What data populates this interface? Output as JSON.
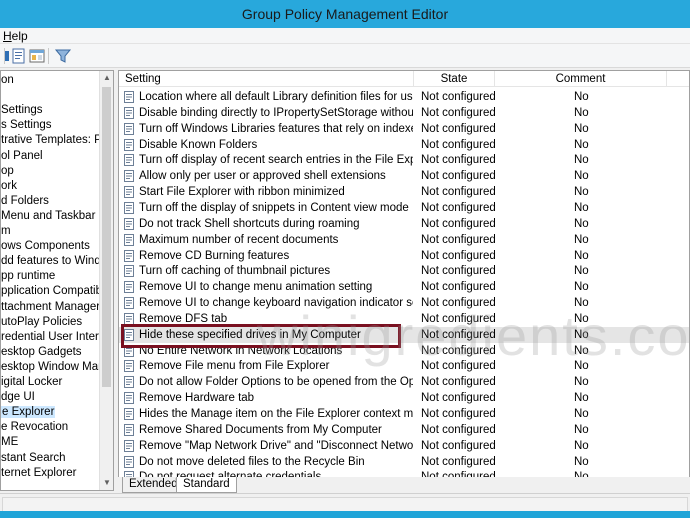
{
  "window": {
    "title": "Group Policy Management Editor"
  },
  "menu": {
    "help_prefix": "",
    "help_accel": "H",
    "help_rest": "elp"
  },
  "toolbar": {
    "icons": [
      "properties-icon",
      "show-hide-pane-icon",
      "filter-icon"
    ]
  },
  "tree": {
    "items": [
      {
        "label": "on",
        "selected": false
      },
      {
        "label": "",
        "selected": false
      },
      {
        "label": " Settings",
        "selected": false
      },
      {
        "label": "s Settings",
        "selected": false
      },
      {
        "label": "trative Templates: Policy",
        "selected": false
      },
      {
        "label": "ol Panel",
        "selected": false
      },
      {
        "label": "op",
        "selected": false
      },
      {
        "label": "ork",
        "selected": false
      },
      {
        "label": "d Folders",
        "selected": false
      },
      {
        "label": "Menu and Taskbar",
        "selected": false
      },
      {
        "label": "m",
        "selected": false
      },
      {
        "label": "ows Components",
        "selected": false
      },
      {
        "label": "dd features to Windows",
        "selected": false
      },
      {
        "label": "pp runtime",
        "selected": false
      },
      {
        "label": "pplication Compatibilit",
        "selected": false
      },
      {
        "label": "ttachment Manager",
        "selected": false
      },
      {
        "label": "utoPlay Policies",
        "selected": false
      },
      {
        "label": "redential User Interface",
        "selected": false
      },
      {
        "label": "esktop Gadgets",
        "selected": false
      },
      {
        "label": "esktop Window Manag",
        "selected": false
      },
      {
        "label": "igital Locker",
        "selected": false
      },
      {
        "label": "dge UI",
        "selected": false
      },
      {
        "label": "e Explorer",
        "selected": true
      },
      {
        "label": "e Revocation",
        "selected": false
      },
      {
        "label": "ME",
        "selected": false
      },
      {
        "label": "stant Search",
        "selected": false
      },
      {
        "label": "ternet Explorer",
        "selected": false
      }
    ]
  },
  "list": {
    "columns": {
      "setting": "Setting",
      "state": "State",
      "comment": "Comment"
    },
    "rows": [
      {
        "setting": "Location where all default Library definition files for users/m...",
        "state": "Not configured",
        "comment": "No"
      },
      {
        "setting": "Disable binding directly to IPropertySetStorage without inter...",
        "state": "Not configured",
        "comment": "No"
      },
      {
        "setting": "Turn off Windows Libraries features that rely on indexed file ...",
        "state": "Not configured",
        "comment": "No"
      },
      {
        "setting": "Disable Known Folders",
        "state": "Not configured",
        "comment": "No"
      },
      {
        "setting": "Turn off display of recent search entries in the File Explorer s...",
        "state": "Not configured",
        "comment": "No"
      },
      {
        "setting": "Allow only per user or approved shell extensions",
        "state": "Not configured",
        "comment": "No"
      },
      {
        "setting": "Start File Explorer with ribbon minimized",
        "state": "Not configured",
        "comment": "No"
      },
      {
        "setting": "Turn off the display of snippets in Content view mode",
        "state": "Not configured",
        "comment": "No"
      },
      {
        "setting": "Do not track Shell shortcuts during roaming",
        "state": "Not configured",
        "comment": "No"
      },
      {
        "setting": "Maximum number of recent documents",
        "state": "Not configured",
        "comment": "No"
      },
      {
        "setting": "Remove CD Burning features",
        "state": "Not configured",
        "comment": "No"
      },
      {
        "setting": "Turn off caching of thumbnail pictures",
        "state": "Not configured",
        "comment": "No"
      },
      {
        "setting": "Remove UI to change menu animation setting",
        "state": "Not configured",
        "comment": "No"
      },
      {
        "setting": "Remove UI to change keyboard navigation indicator setting",
        "state": "Not configured",
        "comment": "No"
      },
      {
        "setting": "Remove DFS tab",
        "state": "Not configured",
        "comment": "No"
      },
      {
        "setting": "Hide these specified drives in My Computer",
        "state": "Not configured",
        "comment": "No"
      },
      {
        "setting": "No Entire Network in Network Locations",
        "state": "Not configured",
        "comment": "No"
      },
      {
        "setting": "Remove File menu from File Explorer",
        "state": "Not configured",
        "comment": "No"
      },
      {
        "setting": "Do not allow Folder Options to be opened from the Options...",
        "state": "Not configured",
        "comment": "No"
      },
      {
        "setting": "Remove Hardware tab",
        "state": "Not configured",
        "comment": "No"
      },
      {
        "setting": "Hides the Manage item on the File Explorer context menu",
        "state": "Not configured",
        "comment": "No"
      },
      {
        "setting": "Remove Shared Documents from My Computer",
        "state": "Not configured",
        "comment": "No"
      },
      {
        "setting": "Remove \"Map Network Drive\" and \"Disconnect Network Dri...",
        "state": "Not configured",
        "comment": "No"
      },
      {
        "setting": "Do not move deleted files to the Recycle Bin",
        "state": "Not configured",
        "comment": "No"
      },
      {
        "setting": "Do not request alternate credentials",
        "state": "Not configured",
        "comment": "No"
      }
    ]
  },
  "tabs": [
    {
      "label": "Extended"
    },
    {
      "label": "Standard"
    }
  ],
  "watermark": "winigredients.com",
  "colors": {
    "title_bar": "#28a8dc",
    "highlight_border": "#7a1020",
    "selected": "#cde8ff"
  }
}
